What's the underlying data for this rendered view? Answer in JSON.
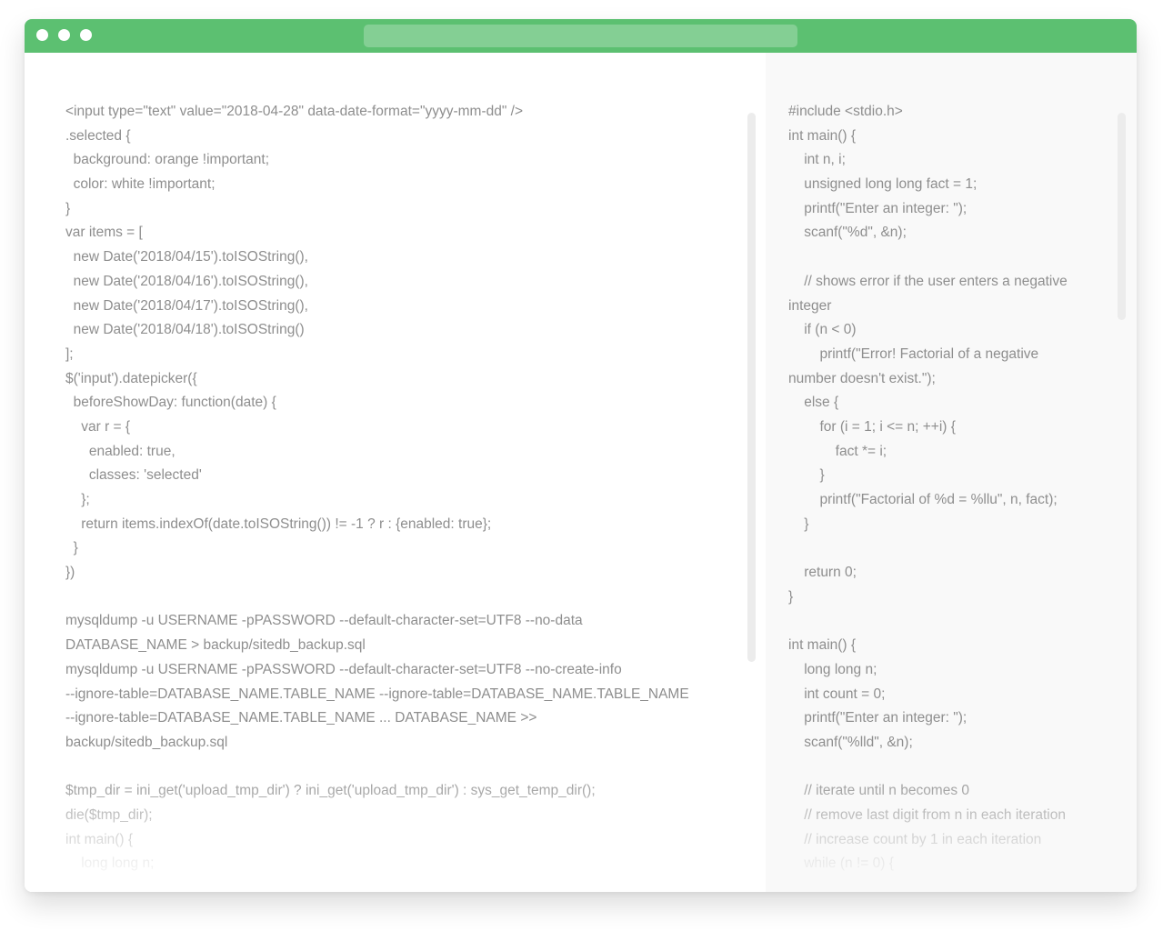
{
  "window": {
    "titlebar_color": "#5cc071",
    "address_bar_color": "#84cf94",
    "controls": [
      "close-dot",
      "minimize-dot",
      "maximize-dot"
    ]
  },
  "editor_left": {
    "lines": [
      "<input type=\"text\" value=\"2018-04-28\" data-date-format=\"yyyy-mm-dd\" />",
      ".selected {",
      "  background: orange !important;",
      "  color: white !important;",
      "}",
      "var items = [",
      "  new Date('2018/04/15').toISOString(),",
      "  new Date('2018/04/16').toISOString(),",
      "  new Date('2018/04/17').toISOString(),",
      "  new Date('2018/04/18').toISOString()",
      "];",
      "$('input').datepicker({",
      "  beforeShowDay: function(date) {",
      "    var r = {",
      "      enabled: true,",
      "      classes: 'selected'",
      "    };",
      "    return items.indexOf(date.toISOString()) != -1 ? r : {enabled: true};",
      "  }",
      "})",
      "",
      "mysqldump -u USERNAME -pPASSWORD --default-character-set=UTF8 --no-data",
      "DATABASE_NAME > backup/sitedb_backup.sql",
      "mysqldump -u USERNAME -pPASSWORD --default-character-set=UTF8 --no-create-info",
      "--ignore-table=DATABASE_NAME.TABLE_NAME --ignore-table=DATABASE_NAME.TABLE_NAME",
      "--ignore-table=DATABASE_NAME.TABLE_NAME ... DATABASE_NAME >>",
      "backup/sitedb_backup.sql",
      "",
      "$tmp_dir = ini_get('upload_tmp_dir') ? ini_get('upload_tmp_dir') : sys_get_temp_dir();",
      "die($tmp_dir);",
      "int main() {",
      "    long long n;"
    ]
  },
  "editor_right": {
    "lines": [
      "#include <stdio.h>",
      "int main() {",
      "    int n, i;",
      "    unsigned long long fact = 1;",
      "    printf(\"Enter an integer: \");",
      "    scanf(\"%d\", &n);",
      "",
      "    // shows error if the user enters a negative",
      "integer",
      "    if (n < 0)",
      "        printf(\"Error! Factorial of a negative",
      "number doesn't exist.\");",
      "    else {",
      "        for (i = 1; i <= n; ++i) {",
      "            fact *= i;",
      "        }",
      "        printf(\"Factorial of %d = %llu\", n, fact);",
      "    }",
      "",
      "    return 0;",
      "}",
      "",
      "int main() {",
      "    long long n;",
      "    int count = 0;",
      "    printf(\"Enter an integer: \");",
      "    scanf(\"%lld\", &n);",
      "",
      "    // iterate until n becomes 0",
      "    // remove last digit from n in each iteration",
      "    // increase count by 1 in each iteration",
      "    while (n != 0) {"
    ]
  }
}
